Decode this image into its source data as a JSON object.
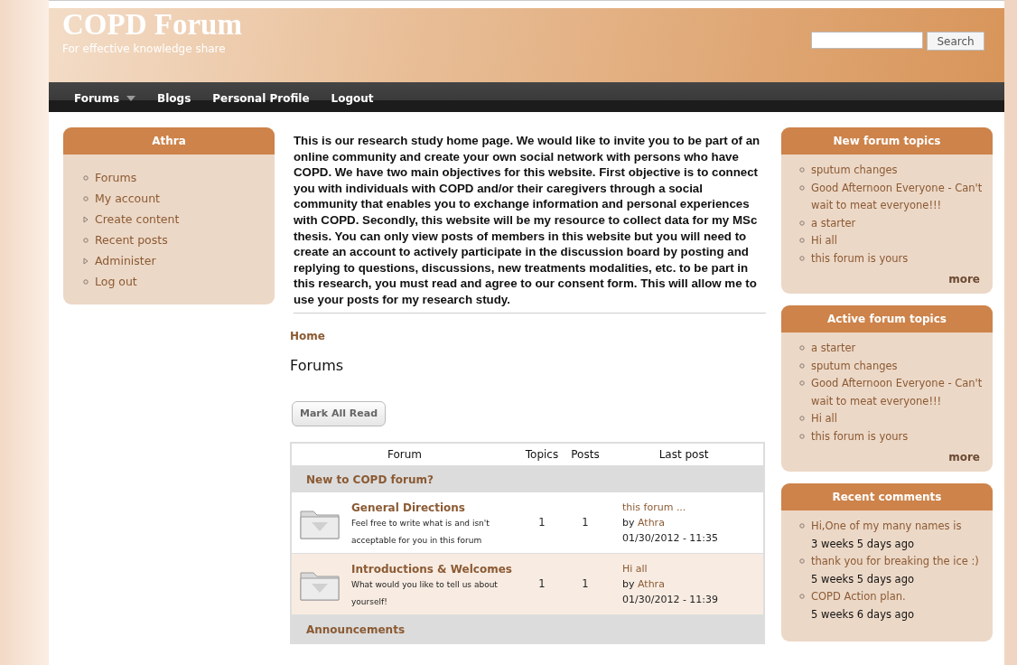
{
  "site": {
    "title": "COPD Forum",
    "slogan": "For effective knowledge share"
  },
  "search": {
    "button": "Search"
  },
  "nav": [
    {
      "label": "Forums",
      "has_menu": true
    },
    {
      "label": "Blogs",
      "has_menu": false
    },
    {
      "label": "Personal Profile",
      "has_menu": false
    },
    {
      "label": "Logout",
      "has_menu": false
    }
  ],
  "user_block": {
    "title": "Athra",
    "items": [
      {
        "label": "Forums",
        "kind": "leaf"
      },
      {
        "label": "My account",
        "kind": "leaf"
      },
      {
        "label": "Create content",
        "kind": "collapsed"
      },
      {
        "label": "Recent posts",
        "kind": "leaf"
      },
      {
        "label": "Administer",
        "kind": "collapsed"
      },
      {
        "label": "Log out",
        "kind": "leaf"
      }
    ]
  },
  "intro": "This is our research study home page. We would like to invite you to be part of an online community and create your own social network with persons who have COPD. We have two main objectives for this website. First objective is to connect you with individuals with COPD and/or their caregivers through a social community that enables you to exchange information and personal experiences with COPD. Secondly, this website will be my resource to collect data for my MSc thesis. You can only view posts of members in this website but you will need to create an account to actively participate in the discussion board by posting and replying to questions, discussions, new treatments modalities, etc. to be part in this research, you must read and agree to our consent form. This will allow me to use your posts for my research study.",
  "breadcrumb": "Home",
  "heading": "Forums",
  "mark_all_read": "Mark All Read",
  "table": {
    "columns": [
      "Forum",
      "Topics",
      "Posts",
      "Last post"
    ],
    "rows": [
      {
        "kind": "category",
        "name": "New to COPD forum?"
      },
      {
        "kind": "forum",
        "name": "General Directions",
        "description": "Feel free to write what is and isn't acceptable for you in this forum",
        "topics": "1",
        "posts": "1",
        "last_title": "this forum ...",
        "last_by": "by",
        "last_author": "Athra",
        "last_date": "01/30/2012 - 11:35"
      },
      {
        "kind": "forum",
        "name": "Introductions & Welcomes",
        "description": "What would you like to tell us about yourself!",
        "topics": "1",
        "posts": "1",
        "last_title": "Hi all",
        "last_by": "by",
        "last_author": "Athra",
        "last_date": "01/30/2012 - 11:39"
      },
      {
        "kind": "category",
        "name": "Announcements"
      }
    ]
  },
  "right_blocks": [
    {
      "title": "New forum topics",
      "items": [
        {
          "label": "sputum changes"
        },
        {
          "label": "Good Afternoon Everyone - Can't wait to meat everyone!!!"
        },
        {
          "label": "a starter"
        },
        {
          "label": "Hi all"
        },
        {
          "label": "this forum is yours"
        }
      ],
      "more": "more"
    },
    {
      "title": "Active forum topics",
      "items": [
        {
          "label": "a starter"
        },
        {
          "label": "sputum changes"
        },
        {
          "label": "Good Afternoon Everyone - Can't wait to meat everyone!!!"
        },
        {
          "label": "Hi all"
        },
        {
          "label": "this forum is yours"
        }
      ],
      "more": "more"
    },
    {
      "title": "Recent comments",
      "items": [
        {
          "label": "Hi,One of my many names is",
          "meta": "3 weeks 5 days ago"
        },
        {
          "label": "thank you for breaking the ice :)",
          "meta": "5 weeks 5 days ago"
        },
        {
          "label": "COPD Action plan.",
          "meta": "5 weeks 6 days ago"
        }
      ]
    }
  ]
}
